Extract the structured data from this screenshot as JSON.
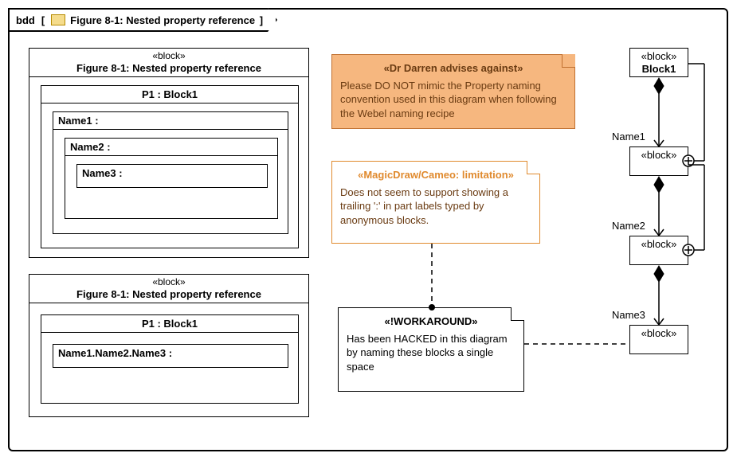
{
  "frame": {
    "kind": "bdd",
    "title": "Figure 8-1: Nested property reference"
  },
  "block1": {
    "stereo": "«block»",
    "name": "Figure 8-1: Nested property reference",
    "p1": "P1 : Block1",
    "n1": "Name1 :",
    "n2": "Name2 :",
    "n3": "Name3 :"
  },
  "block2": {
    "stereo": "«block»",
    "name": "Figure 8-1: Nested property reference",
    "p1": "P1 : Block1",
    "path": "Name1.Name2.Name3 :"
  },
  "noteA": {
    "stereo": "«Dr Darren advises against»",
    "body": "Please DO NOT mimic the Property naming convention used in this diagram when following the Webel naming recipe"
  },
  "noteB": {
    "stereo": "«MagicDraw/Cameo: limitation»",
    "body": "Does not seem to support showing a trailing ':' in part labels typed by anonymous blocks."
  },
  "noteC": {
    "stereo": "«!WORKAROUND»",
    "body": "Has been HACKED in this diagram by naming these blocks a single space"
  },
  "chain": {
    "b0": {
      "stereo": "«block»",
      "name": "Block1"
    },
    "l1": "Name1",
    "b1": "«block»",
    "l2": "Name2",
    "b2": "«block»",
    "l3": "Name3",
    "b3": "«block»"
  }
}
